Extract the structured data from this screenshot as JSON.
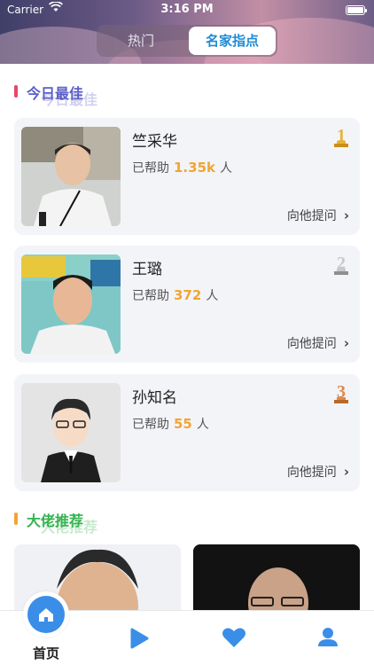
{
  "status_bar": {
    "carrier": "Carrier",
    "time": "3:16 PM"
  },
  "segments": {
    "hot": "热门",
    "experts": "名家指点"
  },
  "section_today": {
    "title": "今日最佳",
    "ghost": "今日最佳",
    "accent": "#e8466a",
    "title_color": "#5b5fc7"
  },
  "section_recommend": {
    "title": "大佬推荐",
    "ghost": "大佬推荐",
    "accent": "#f2a531",
    "title_color": "#35b34f"
  },
  "cards": [
    {
      "name": "竺采华",
      "helped_prefix": "已帮助",
      "helped_count": "1.35k",
      "helped_suffix": "人",
      "ask": "向他提问",
      "rank": "1"
    },
    {
      "name": "王璐",
      "helped_prefix": "已帮助",
      "helped_count": "372",
      "helped_suffix": "人",
      "ask": "向他提问",
      "rank": "2"
    },
    {
      "name": "孙知名",
      "helped_prefix": "已帮助",
      "helped_count": "55",
      "helped_suffix": "人",
      "ask": "向他提问",
      "rank": "3"
    }
  ],
  "tabbar": {
    "home": "首页",
    "icons": [
      "home-icon",
      "play-icon",
      "heart-icon",
      "user-icon"
    ],
    "accent": "#3a8ee8"
  }
}
